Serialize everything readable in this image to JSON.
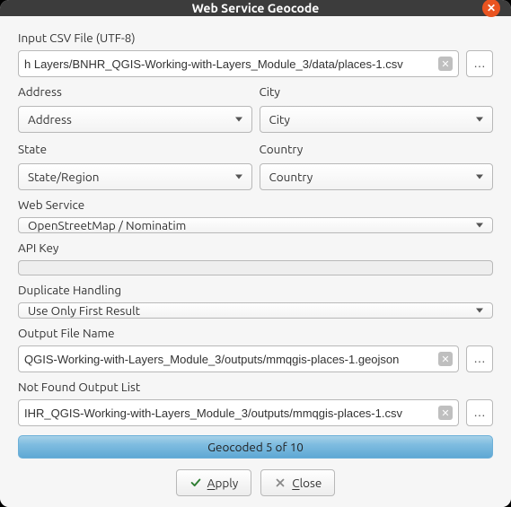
{
  "window": {
    "title": "Web Service Geocode"
  },
  "labels": {
    "input_csv": "Input CSV File (UTF-8)",
    "address": "Address",
    "city": "City",
    "state": "State",
    "country": "Country",
    "web_service": "Web Service",
    "api_key": "API Key",
    "duplicate": "Duplicate Handling",
    "output_file": "Output File Name",
    "not_found": "Not Found Output List"
  },
  "fields": {
    "input_csv": "h Layers/BNHR_QGIS-Working-with-Layers_Module_3/data/places-1.csv",
    "address": "Address",
    "city": "City",
    "state": "State/Region",
    "country": "Country",
    "web_service": "OpenStreetMap / Nominatim",
    "api_key": "",
    "duplicate": "Use Only First Result",
    "output_file": "QGIS-Working-with-Layers_Module_3/outputs/mmqgis-places-1.geojson",
    "not_found": "IHR_QGIS-Working-with-Layers_Module_3/outputs/mmqgis-places-1.csv"
  },
  "progress": {
    "text": "Geocoded 5 of 10"
  },
  "buttons": {
    "apply": "Apply",
    "close": "Close",
    "browse": "…"
  }
}
